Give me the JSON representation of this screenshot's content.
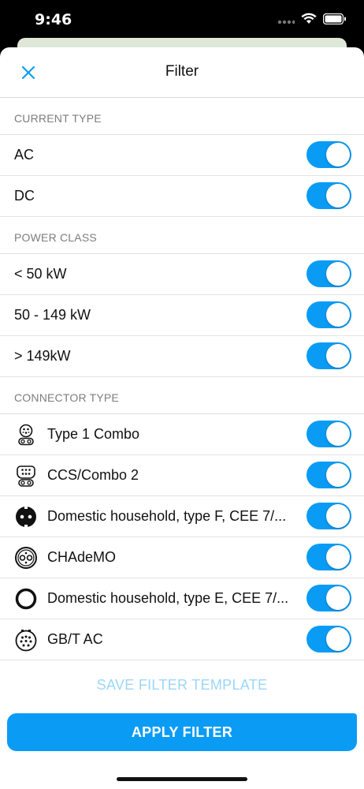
{
  "status": {
    "time": "9:46"
  },
  "header": {
    "title": "Filter"
  },
  "sections": {
    "current_type": {
      "label": "CURRENT TYPE",
      "items": [
        {
          "label": "AC",
          "enabled": true
        },
        {
          "label": "DC",
          "enabled": true
        }
      ]
    },
    "power_class": {
      "label": "POWER CLASS",
      "items": [
        {
          "label": "< 50 kW",
          "enabled": true
        },
        {
          "label": "50 - 149 kW",
          "enabled": true
        },
        {
          "label": "> 149kW",
          "enabled": true
        }
      ]
    },
    "connector_type": {
      "label": "CONNECTOR TYPE",
      "items": [
        {
          "label": "Type 1 Combo",
          "icon": "type1-combo-icon",
          "enabled": true
        },
        {
          "label": "CCS/Combo 2",
          "icon": "ccs-combo2-icon",
          "enabled": true
        },
        {
          "label": "Domestic household, type F, CEE 7/...",
          "icon": "schuko-plug-icon",
          "enabled": true
        },
        {
          "label": "CHAdeMO",
          "icon": "chademo-icon",
          "enabled": true
        },
        {
          "label": "Domestic household, type E, CEE 7/...",
          "icon": "type-e-plug-icon",
          "enabled": true
        },
        {
          "label": "GB/T AC",
          "icon": "gbt-ac-icon",
          "enabled": true
        }
      ]
    }
  },
  "footer": {
    "save_template": "SAVE FILTER TEMPLATE",
    "apply": "APPLY FILTER"
  },
  "colors": {
    "accent": "#0a9cf5",
    "save_template_text": "#9cd6f9"
  }
}
